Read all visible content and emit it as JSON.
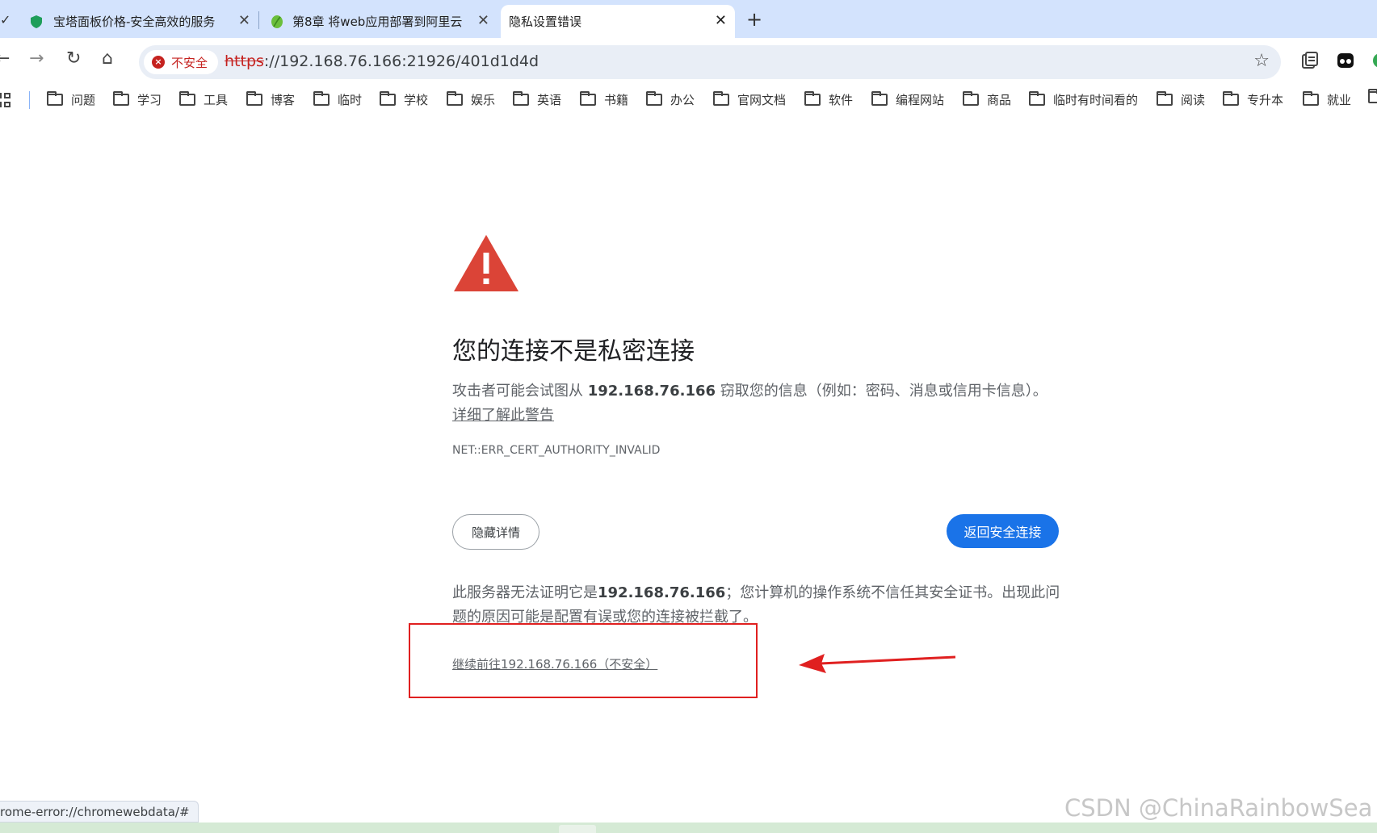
{
  "tabs": [
    {
      "title": "宝塔面板价格-安全高效的服务",
      "close": "✕"
    },
    {
      "title": "第8章 将web应用部署到阿里云",
      "close": "✕"
    },
    {
      "title": "隐私设置错误",
      "close": "✕"
    }
  ],
  "new_tab": "+",
  "toolbar": {
    "back": "←",
    "forward": "→",
    "reload": "↻",
    "home": "⌂",
    "security_label": "不安全",
    "url_scheme": "https",
    "url_rest": "://192.168.76.166:21926/401d1d4d",
    "star": "☆"
  },
  "bookmarks": [
    "问题",
    "学习",
    "工具",
    "博客",
    "临时",
    "学校",
    "娱乐",
    "英语",
    "书籍",
    "办公",
    "官网文档",
    "软件",
    "编程网站",
    "商品",
    "临时有时间看的",
    "阅读",
    "专升本",
    "就业"
  ],
  "error_page": {
    "heading": "您的连接不是私密连接",
    "p1_prefix": "攻击者可能会试图从 ",
    "p1_host": "192.168.76.166",
    "p1_suffix": " 窃取您的信息（例如：密码、消息或信用卡信息）。",
    "learn_more": "详细了解此警告",
    "error_code": "NET::ERR_CERT_AUTHORITY_INVALID",
    "hide_details": "隐藏详情",
    "back_to_safety": "返回安全连接",
    "p2_prefix": "此服务器无法证明它是",
    "p2_host": "192.168.76.166",
    "p2_suffix": "；您计算机的操作系统不信任其安全证书。出现此问题的原因可能是配置有误或您的连接被拦截了。",
    "proceed_link": "继续前往192.168.76.166（不安全）"
  },
  "status_text": "rome-error://chromewebdata/#",
  "watermark": "CSDN @ChinaRainbowSea",
  "colors": {
    "tab_strip": "#d3e3fd",
    "primary_button": "#1a73e8",
    "warning_red": "#db4437",
    "annotation_red": "#e02020"
  },
  "icons": [
    "shield-icon",
    "leaf-icon",
    "close-icon",
    "back-icon",
    "forward-icon",
    "reload-icon",
    "home-icon",
    "warning-icon",
    "star-icon",
    "tab-search-icon",
    "extension-icon",
    "folder-icon",
    "apps-icon"
  ]
}
